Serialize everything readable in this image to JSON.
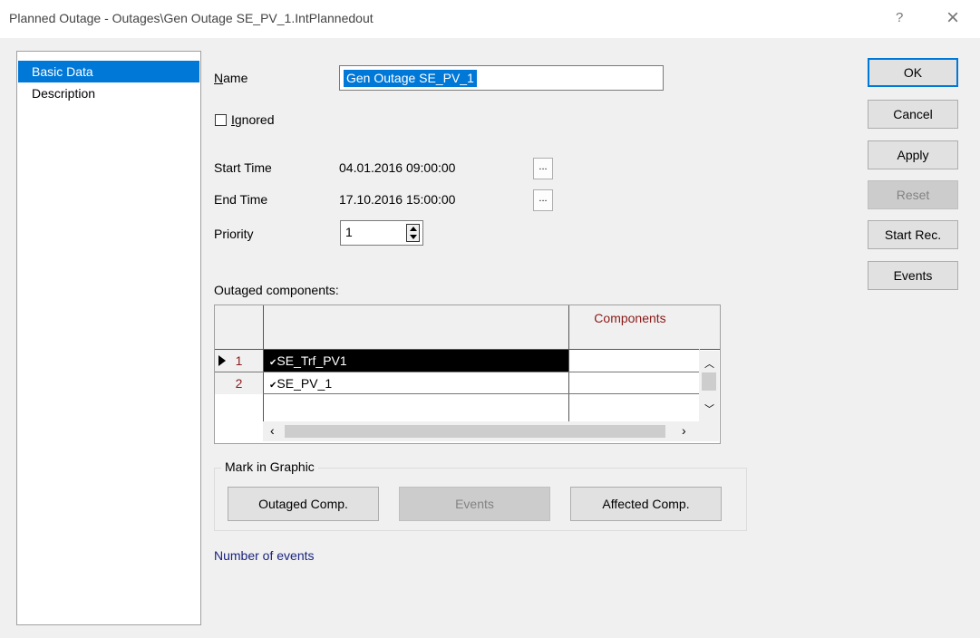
{
  "window": {
    "title": "Planned Outage - Outages\\Gen Outage SE_PV_1.IntPlannedout",
    "help": "?",
    "close": "×"
  },
  "nav": {
    "items": [
      {
        "label": "Basic Data",
        "selected": true
      },
      {
        "label": "Description",
        "selected": false
      }
    ]
  },
  "form": {
    "name_label": "Name",
    "name_value": "Gen Outage SE_PV_1",
    "ignored_label": "Ignored",
    "ignored_checked": false,
    "start_time_label": "Start Time",
    "start_time_value": "04.01.2016 09:00:00",
    "end_time_label": "End Time",
    "end_time_value": "17.10.2016 15:00:00",
    "picker_button": "...",
    "priority_label": "Priority",
    "priority_value": "1"
  },
  "components": {
    "section_label": "Outaged components:",
    "column_header": "Components",
    "rows": [
      {
        "num": "1",
        "value": "SE_Trf_PV1",
        "current": true,
        "selected": true
      },
      {
        "num": "2",
        "value": "SE_PV_1",
        "current": false,
        "selected": false
      }
    ],
    "check_mark": "✔"
  },
  "mark_in_graphic": {
    "legend": "Mark in Graphic",
    "outaged_comp": "Outaged Comp.",
    "events": "Events",
    "affected_comp": "Affected Comp."
  },
  "number_of_events": "Number of events",
  "buttons": {
    "ok": "OK",
    "cancel": "Cancel",
    "apply": "Apply",
    "reset": "Reset",
    "start_rec": "Start Rec.",
    "events": "Events"
  },
  "colors": {
    "accent": "#0078d7",
    "header_text": "#8b1a1a",
    "link": "#1a237e"
  }
}
